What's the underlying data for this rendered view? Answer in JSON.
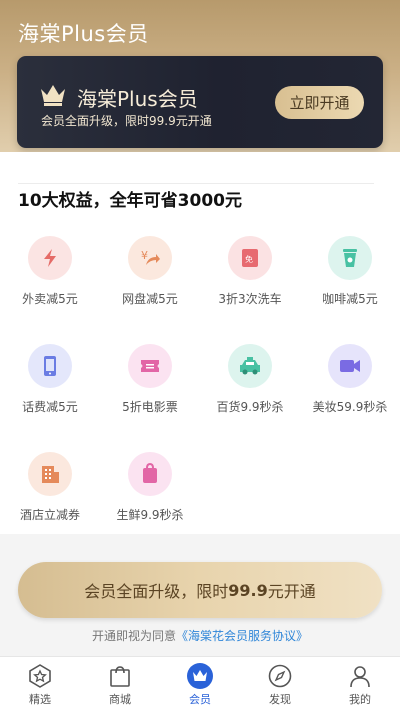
{
  "header": {
    "title": "海棠Plus会员"
  },
  "card": {
    "title": "海棠Plus会员",
    "subtitle": "会员全面升级，限时99.9元开通",
    "button": "立即开通"
  },
  "benefits": {
    "title": "10大权益，全年可省3000元",
    "items": [
      {
        "label": "外卖减5元",
        "icon": "lightning-icon"
      },
      {
        "label": "网盘减5元",
        "icon": "yen-arrow-icon"
      },
      {
        "label": "3折3次洗车",
        "icon": "coupon-icon"
      },
      {
        "label": "咖啡减5元",
        "icon": "coffee-cup-icon"
      },
      {
        "label": "话费减5元",
        "icon": "phone-icon"
      },
      {
        "label": "5折电影票",
        "icon": "ticket-icon"
      },
      {
        "label": "百货9.9秒杀",
        "icon": "taxi-icon"
      },
      {
        "label": "美妆59.9秒杀",
        "icon": "video-icon"
      },
      {
        "label": "酒店立减券",
        "icon": "hotel-icon"
      },
      {
        "label": "生鲜9.9秒杀",
        "icon": "bag-icon"
      }
    ]
  },
  "cta": {
    "prefix": "会员全面升级，限时",
    "price": "99.9",
    "suffix": "元开通"
  },
  "agreement": {
    "prefix": "开通即视为同意",
    "link": "《海棠花会员服务协议》"
  },
  "tabbar": {
    "items": [
      {
        "label": "精选"
      },
      {
        "label": "商城"
      },
      {
        "label": "会员"
      },
      {
        "label": "发现"
      },
      {
        "label": "我的"
      }
    ]
  },
  "colors": {
    "gold": "#cdb184",
    "dark_card": "#23263a",
    "active_tab": "#2a62d8"
  }
}
